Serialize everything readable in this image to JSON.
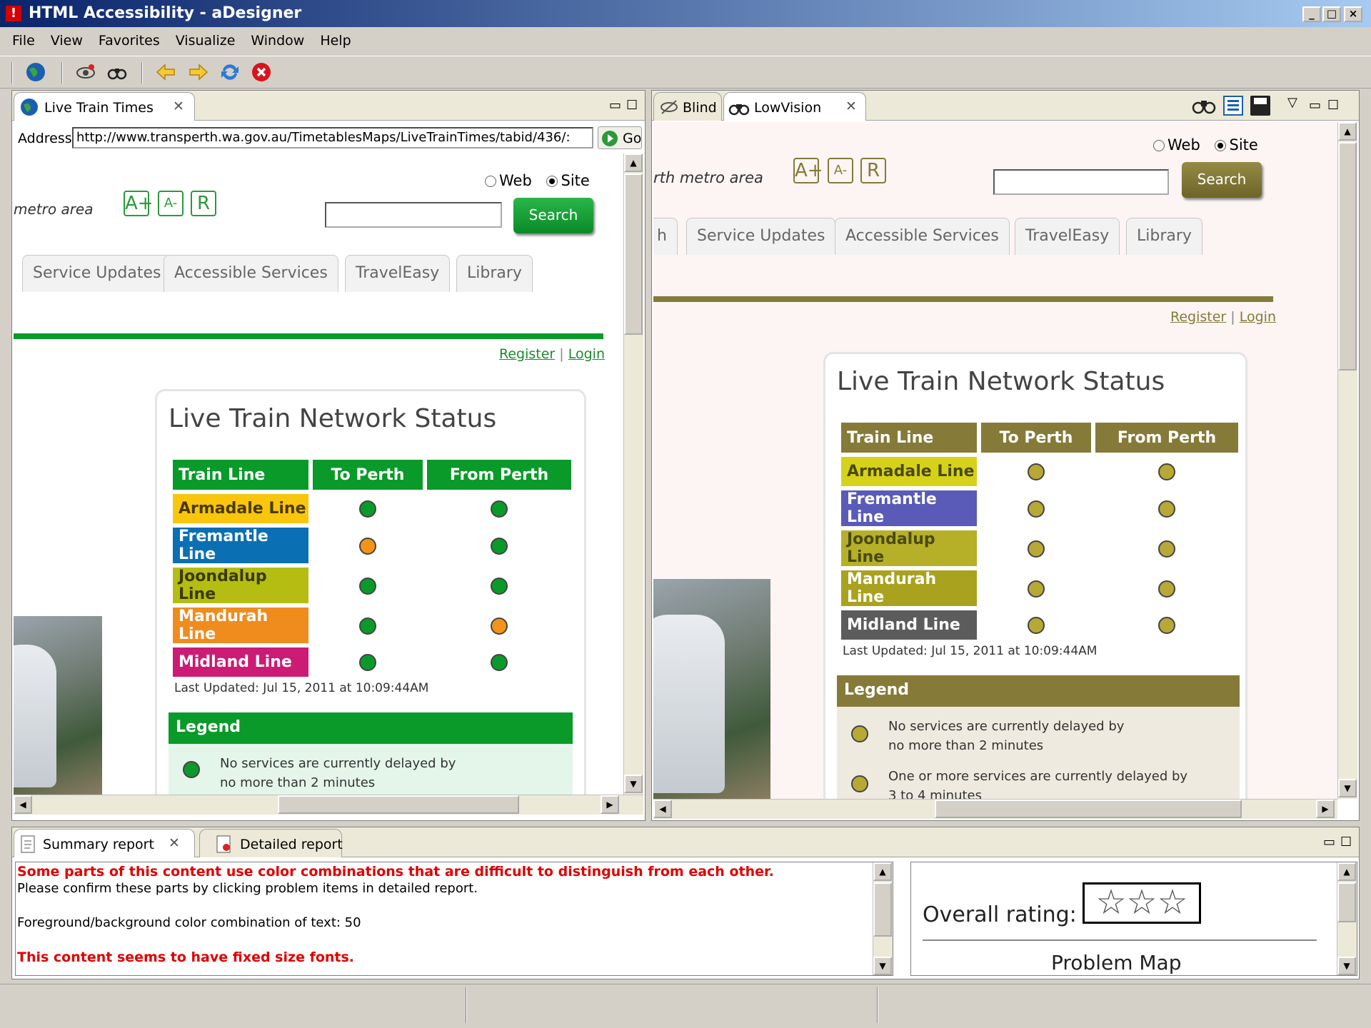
{
  "window": {
    "title": "HTML Accessibility - aDesigner",
    "min": "_",
    "max": "□",
    "close": "×"
  },
  "menu": [
    "File",
    "View",
    "Favorites",
    "Visualize",
    "Window",
    "Help"
  ],
  "toolbar": {
    "icons": [
      "globe-icon",
      "eye-settings-icon",
      "binoculars-icon",
      "back-arrow-icon",
      "forward-arrow-icon",
      "refresh-icon",
      "stop-icon"
    ]
  },
  "browser": {
    "tab_label": "Live Train Times",
    "address_label": "Address",
    "address_value": "http://www.transperth.wa.gov.au/TimetablesMaps/LiveTrainTimes/tabid/436/:",
    "go_label": "Go"
  },
  "site": {
    "metro": "metro area",
    "metro_right": "rth metro area",
    "font_buttons": [
      "A+",
      "A-",
      "R"
    ],
    "radio_web": "Web",
    "radio_site": "Site",
    "search_label": "Search",
    "nav_left": [
      "Service Updates",
      "Accessible Services",
      "TravelEasy",
      "Library"
    ],
    "nav_right": [
      "h",
      "Service Updates",
      "Accessible Services",
      "TravelEasy",
      "Library"
    ],
    "register": "Register",
    "login": "Login",
    "separator": "|",
    "status_title": "Live Train Network Status",
    "headers": [
      "Train Line",
      "To Perth",
      "From Perth"
    ],
    "lines": [
      "Armadale Line",
      "Fremantle Line",
      "Joondalup Line",
      "Mandurah Line",
      "Midland Line"
    ],
    "to_perth_status": [
      "green",
      "orange",
      "green",
      "green",
      "green"
    ],
    "from_perth_status": [
      "green",
      "green",
      "green",
      "orange",
      "green"
    ],
    "last_updated": "Last Updated: Jul 15, 2011 at 10:09:44AM",
    "legend_title": "Legend",
    "legend_1a": "No services are currently delayed by",
    "legend_1b": "no more than 2 minutes",
    "legend_2a": "One or more services are currently delayed by",
    "legend_2b": "3 to 4 minutes"
  },
  "colors": {
    "green": "#0a9a2a",
    "orange": "#f39419",
    "armadale": "#f9c60d",
    "fremantle": "#0b6fb3",
    "joondalup": "#b5bd13",
    "mandurah": "#f08b1e",
    "midland": "#cc1b74",
    "lv_header": "#857a38",
    "lv_dot": "#b8a836",
    "lv_armadale": "#d6d21a",
    "lv_fremantle": "#5a5ab8",
    "lv_joondalup": "#b6b029",
    "lv_mandurah": "#a9a21e",
    "lv_midland": "#5c5c5c"
  },
  "views": {
    "blind_tab": "Blind",
    "lowvision_tab": "LowVision"
  },
  "reports": {
    "summary_tab": "Summary report",
    "detailed_tab": "Detailed report",
    "line1": "Some parts of this content use color combinations that are difficult to distinguish from each other.",
    "line2": "Please confirm these parts by clicking problem items in detailed report.",
    "line3": "Foreground/background color combination of text: 50",
    "line4": "This content seems to have fixed size fonts.",
    "overall_rating": "Overall rating:",
    "stars": "☆☆☆",
    "problem_map": "Problem Map"
  }
}
